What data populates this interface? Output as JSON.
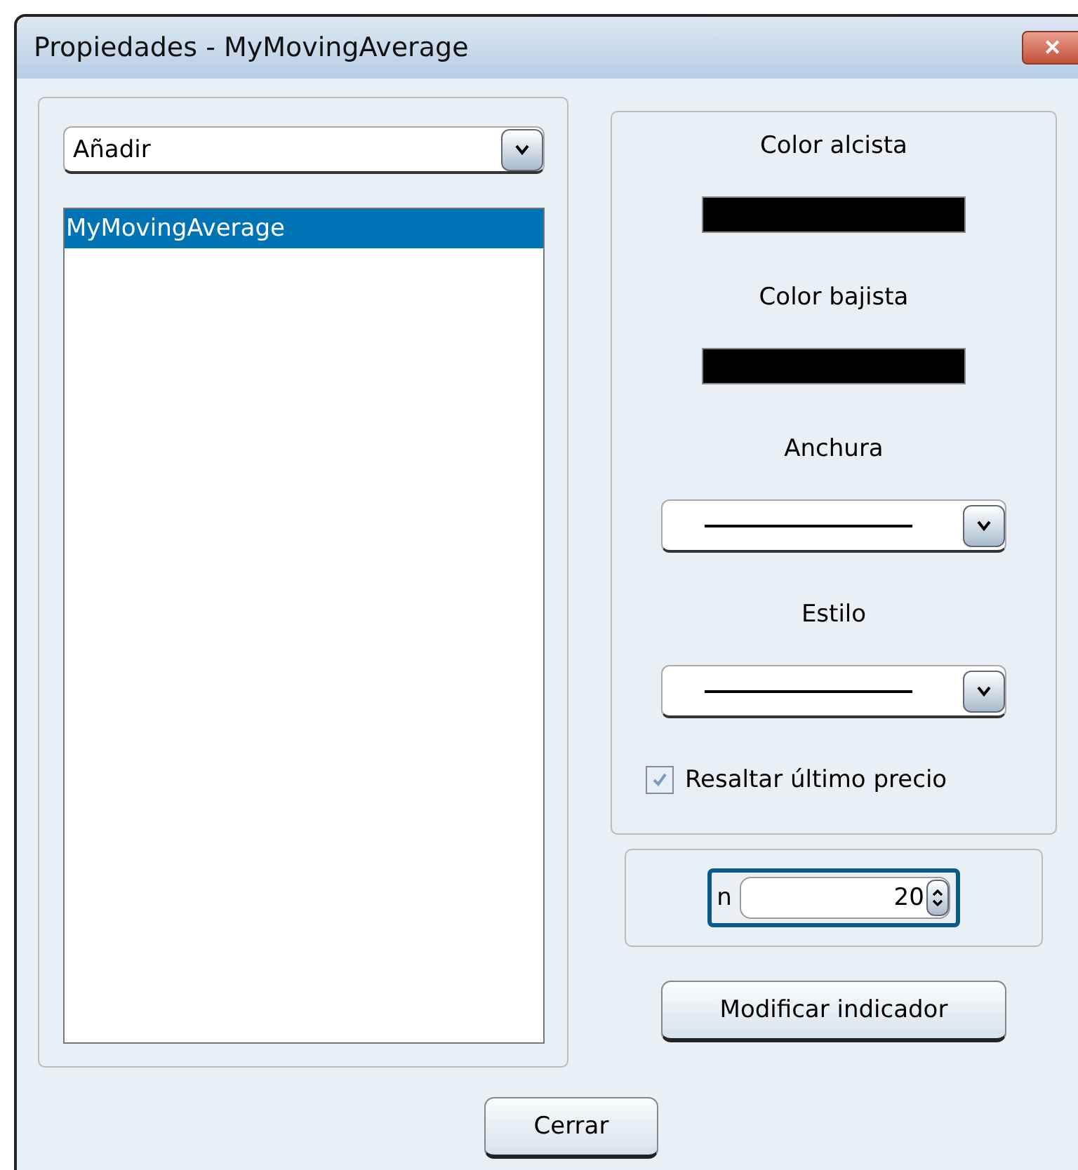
{
  "window": {
    "title": "Propiedades - MyMovingAverage",
    "close": "✕"
  },
  "add_dropdown": {
    "value": "Añadir"
  },
  "indicators": [
    {
      "label": "MyMovingAverage",
      "selected": true
    }
  ],
  "colors": [
    {
      "label": "Color alcista",
      "color": "#000000"
    },
    {
      "label": "Color bajista",
      "color": "#000000"
    }
  ],
  "line_selects": [
    {
      "label": "Anchura"
    },
    {
      "label": "Estilo"
    }
  ],
  "highlight_last_price": {
    "label": "Resaltar último precio",
    "checked": true
  },
  "parameter": {
    "label": "n",
    "value": "20"
  },
  "buttons": {
    "modify": "Modificar indicador",
    "close": "Cerrar"
  }
}
